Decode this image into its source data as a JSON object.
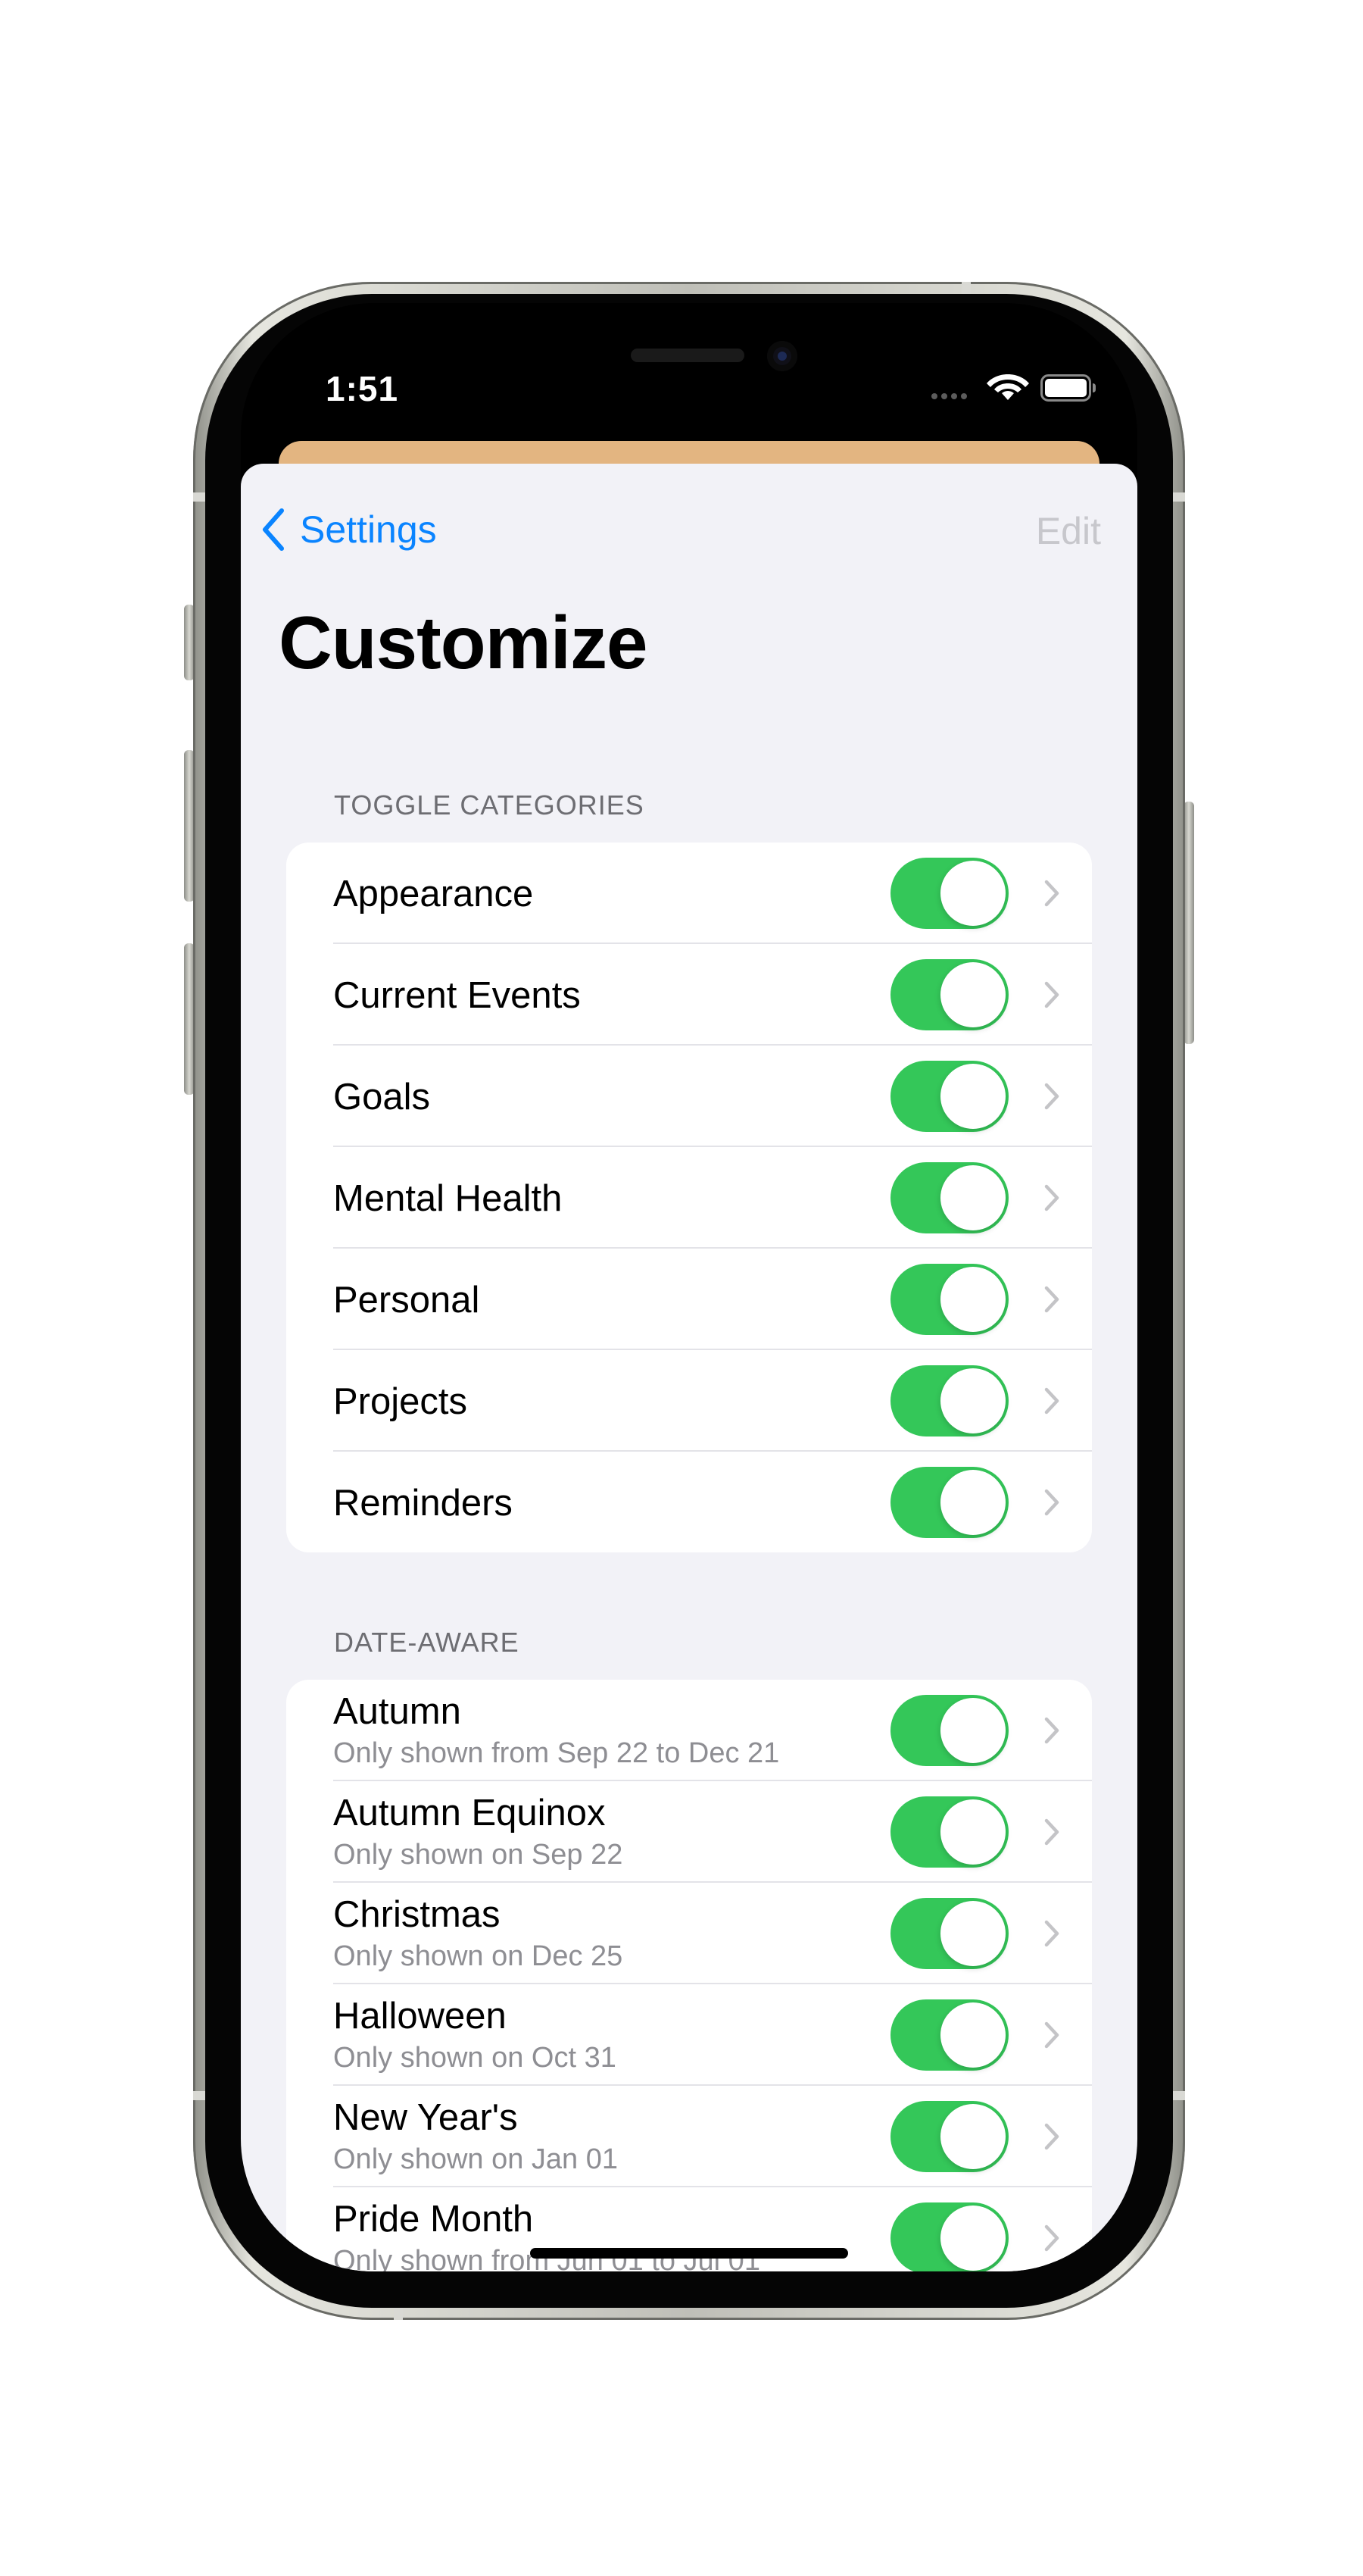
{
  "status_bar": {
    "time": "1:51"
  },
  "nav": {
    "back_label": "Settings",
    "edit_label": "Edit"
  },
  "page": {
    "title": "Customize"
  },
  "sections": {
    "toggle_categories": {
      "header": "TOGGLE CATEGORIES",
      "items": [
        {
          "label": "Appearance",
          "enabled": true
        },
        {
          "label": "Current Events",
          "enabled": true
        },
        {
          "label": "Goals",
          "enabled": true
        },
        {
          "label": "Mental Health",
          "enabled": true
        },
        {
          "label": "Personal",
          "enabled": true
        },
        {
          "label": "Projects",
          "enabled": true
        },
        {
          "label": "Reminders",
          "enabled": true
        }
      ]
    },
    "date_aware": {
      "header": "DATE-AWARE",
      "items": [
        {
          "title": "Autumn",
          "subtitle": "Only shown from Sep 22 to Dec 21",
          "enabled": true
        },
        {
          "title": "Autumn Equinox",
          "subtitle": "Only shown on Sep 22",
          "enabled": true
        },
        {
          "title": "Christmas",
          "subtitle": "Only shown on Dec 25",
          "enabled": true
        },
        {
          "title": "Halloween",
          "subtitle": "Only shown on Oct 31",
          "enabled": true
        },
        {
          "title": "New Year's",
          "subtitle": "Only shown on Jan 01",
          "enabled": true
        },
        {
          "title": "Pride Month",
          "subtitle": "Only shown from Jun 01 to Jul 01",
          "enabled": true
        }
      ]
    }
  },
  "colors": {
    "accent": "#0a84ff",
    "toggle_on": "#34c759",
    "background": "#f2f2f7",
    "sheet_peek": "#e3b581"
  },
  "icons": {
    "back": "chevron-left-icon",
    "row_disclosure": "chevron-right-icon",
    "wifi": "wifi-icon",
    "battery": "battery-icon"
  }
}
